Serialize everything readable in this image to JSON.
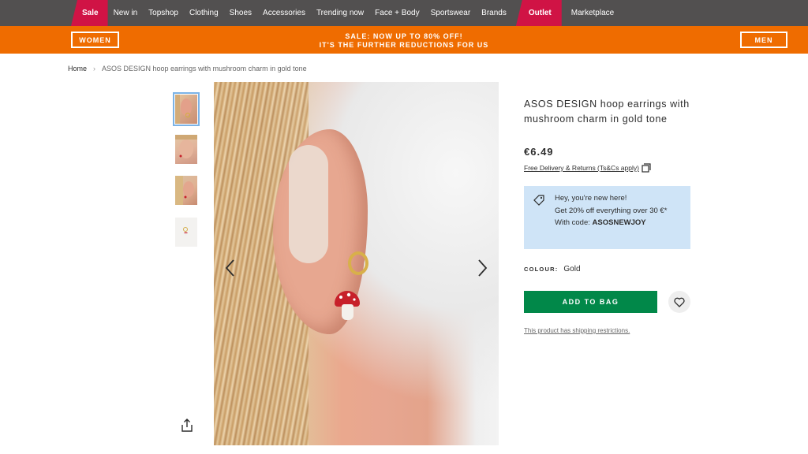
{
  "nav": {
    "items": [
      "Sale",
      "New in",
      "Topshop",
      "Clothing",
      "Shoes",
      "Accessories",
      "Trending now",
      "Face + Body",
      "Sportswear",
      "Brands",
      "Outlet",
      "Marketplace"
    ]
  },
  "promo": {
    "women_label": "WOMEN",
    "men_label": "MEN",
    "line1": "SALE: NOW UP TO 80% OFF!",
    "line2": "IT'S THE FURTHER REDUCTIONS FOR US"
  },
  "breadcrumb": {
    "home": "Home",
    "separator": "›",
    "current": "ASOS DESIGN hoop earrings with mushroom charm in gold tone"
  },
  "product": {
    "title": "ASOS DESIGN hoop earrings with mushroom charm in gold tone",
    "price": "€6.49",
    "delivery": "Free Delivery & Returns (Ts&Cs apply)",
    "promo_line1": "Hey, you're new here!",
    "promo_line2": "Get 20% off everything over 30 €*",
    "promo_code_prefix": "With code: ",
    "promo_code": "ASOSNEWJOY",
    "colour_label": "COLOUR:",
    "colour_value": "Gold",
    "add_to_bag": "ADD TO BAG",
    "shipping_restrictions": "This product has shipping restrictions."
  },
  "colors": {
    "nav_bg": "#525050",
    "sale_red": "#d01345",
    "promo_orange": "#ef6c00",
    "add_to_bag_green": "#018849",
    "promo_box_blue": "#cfe4f7"
  },
  "icons": [
    "chevron-left-icon",
    "chevron-right-icon",
    "share-icon",
    "copy-icon",
    "price-tag-icon",
    "heart-icon"
  ]
}
